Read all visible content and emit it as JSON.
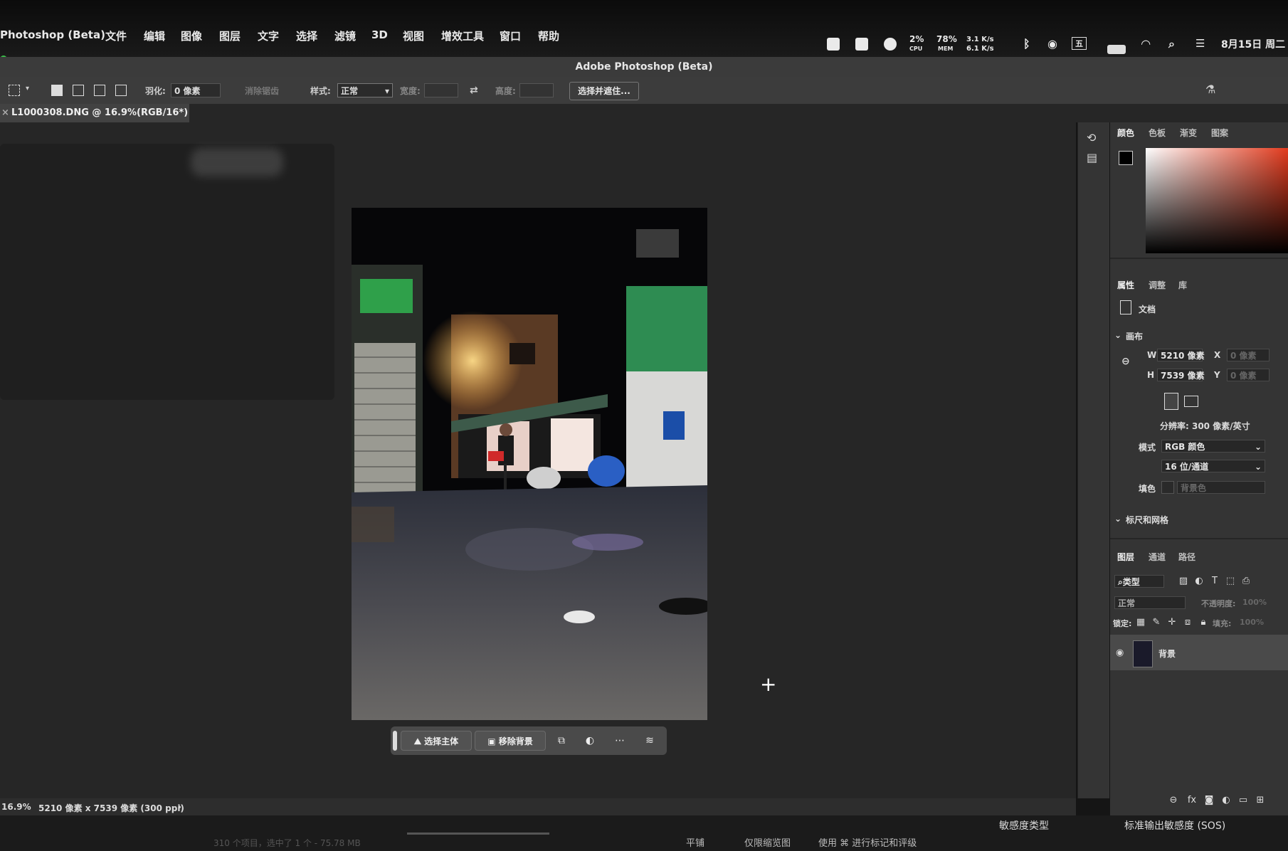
{
  "menubar": {
    "app": "Photoshop (Beta)",
    "items": [
      "文件",
      "编辑",
      "图像",
      "图层",
      "文字",
      "选择",
      "滤镜",
      "3D",
      "视图",
      "增效工具",
      "窗口",
      "帮助"
    ],
    "cpu": "2%",
    "cpu_label": "CPU",
    "mem": "78%",
    "mem_label": "MEM",
    "net_up": "3.1 K/s",
    "net_down": "6.1 K/s",
    "input_method": "五",
    "date": "8月15日 周二"
  },
  "window": {
    "title": "Adobe Photoshop (Beta)"
  },
  "options": {
    "feather_label": "羽化:",
    "feather_value": "0 像素",
    "antialias_label": "消除锯齿",
    "style_label": "样式:",
    "style_value": "正常",
    "width_label": "宽度:",
    "height_label": "高度:",
    "select_mask_button": "选择并遮住...",
    "share_button": "共享"
  },
  "document": {
    "tab_title": "L1000308.DNG @ 16.9%(RGB/16*) *"
  },
  "contextbar": {
    "select_subject": "选择主体",
    "remove_background": "移除背景"
  },
  "statusbar": {
    "zoom": "16.9%",
    "info": "5210 像素 x 7539 像素 (300 ppi)"
  },
  "bottom_strip": {
    "items_count": "310 个项目，选中了 1 个 - 75.78 MB",
    "tile": "平铺",
    "thumb_only": "仅限缩览图",
    "use_rating": "使用 ⌘ 进行标记和评级",
    "sensitivity_type": "敏感度类型",
    "sos": "标准输出敏感度 (SOS)"
  },
  "color_panel": {
    "tabs": [
      "颜色",
      "色板",
      "渐变",
      "图案"
    ],
    "accent": "#e23b1e"
  },
  "properties_panel": {
    "tabs": [
      "属性",
      "调整",
      "库"
    ],
    "doc_label": "文档",
    "canvas_section": "画布",
    "w_label": "W",
    "w_value": "5210 像素",
    "h_label": "H",
    "h_value": "7539 像素",
    "x_label": "X",
    "x_placeholder": "0 像素",
    "y_label": "Y",
    "y_placeholder": "0 像素",
    "resolution": "分辨率: 300 像素/英寸",
    "mode_label": "模式",
    "mode_value": "RGB 颜色",
    "depth_value": "16 位/通道",
    "fill_label": "填色",
    "fill_value": "背景色",
    "rulers_section": "标尺和网格"
  },
  "layers_panel": {
    "tabs": [
      "图层",
      "通道",
      "路径"
    ],
    "filter_kind": "类型",
    "blend_mode": "正常",
    "opacity_label": "不透明度:",
    "opacity_value": "100%",
    "lock_label": "锁定:",
    "fill_label": "填充:",
    "fill_value": "100%",
    "layer_name": "背景"
  },
  "accent_blue": "#1a6ef5"
}
